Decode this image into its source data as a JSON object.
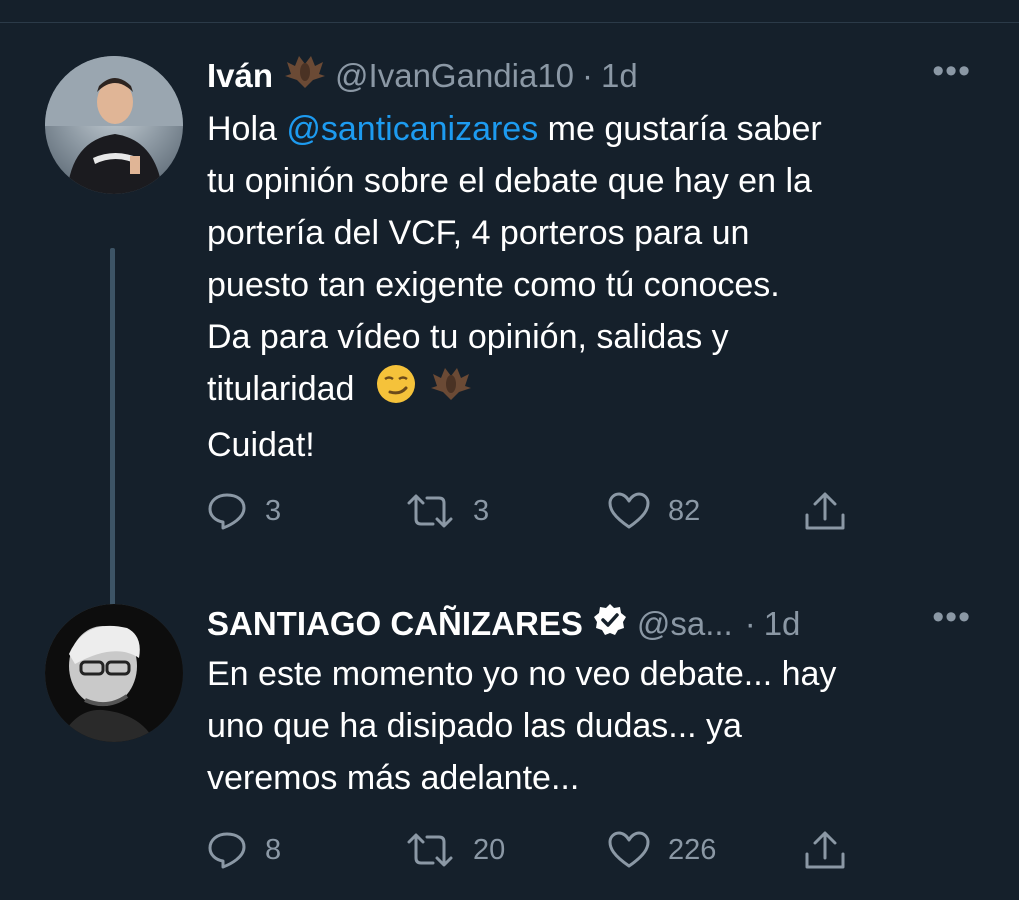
{
  "tweets": [
    {
      "name": "Iván",
      "handle": "@IvanGandia10",
      "separator": "·",
      "time": "1d",
      "more": "•••",
      "text_lines": [
        {
          "prefix": "Hola ",
          "mention": "@santicanizares",
          "suffix": " me gustaría saber"
        },
        "tu opinión sobre el debate que hay en la",
        "portería del VCF, 4 porteros para un",
        "puesto tan exigente como tú conoces.",
        "Da para vídeo tu opinión, salidas y",
        "titularidad",
        "Cuidat!"
      ],
      "icons": {
        "name_emoji": "bat-emoji-icon",
        "end_emojis": [
          "smirk-emoji-icon",
          "bat-emoji-icon"
        ]
      },
      "counts": {
        "replies": "3",
        "retweets": "3",
        "likes": "82"
      }
    },
    {
      "name": "SANTIAGO CAÑIZARES",
      "handle": "@sa...",
      "separator": "·",
      "time": "1d",
      "more": "•••",
      "verified": true,
      "text_lines": [
        "En este momento yo no veo debate... hay",
        "uno que ha disipado las dudas... ya",
        "veremos más adelante..."
      ],
      "counts": {
        "replies": "8",
        "retweets": "20",
        "likes": "226"
      }
    }
  ],
  "colors": {
    "background": "#15202b",
    "text": "#ffffff",
    "secondary": "#8b98a5",
    "mention": "#1d9bf0",
    "thread_line": "#3d5466"
  }
}
